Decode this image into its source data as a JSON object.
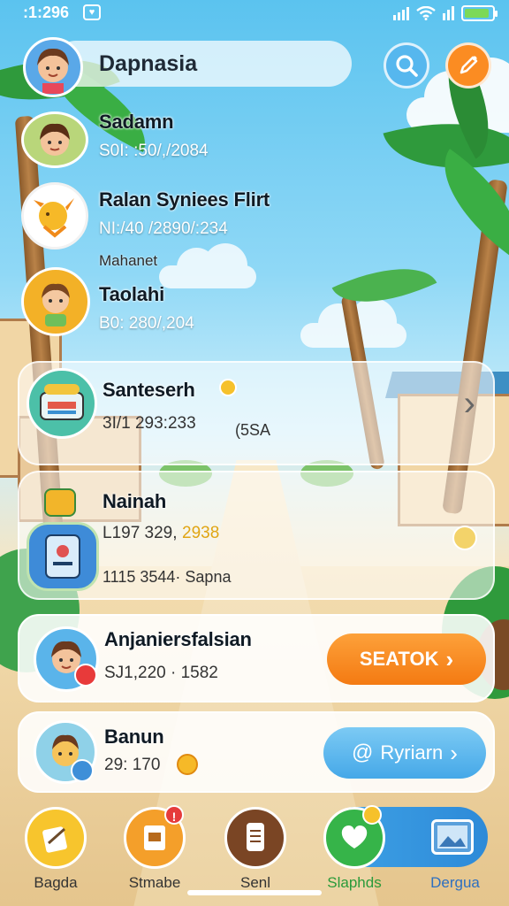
{
  "status_bar": {
    "time": ":1:296",
    "notification_badge": "♥"
  },
  "header": {
    "title": "Dapnasia",
    "search_icon": "search-icon",
    "edit_icon": "pen-icon"
  },
  "contacts": [
    {
      "name": "Sadamn",
      "meta": "S0I: :50/,/2084"
    },
    {
      "name": "Ralan Syniees Flirt",
      "meta": "NI:/40 /2890/:234",
      "sub": "Mahanet"
    },
    {
      "name": "Taolahi",
      "meta": "B0: 280/,204"
    }
  ],
  "cards": [
    {
      "name": "Santeserh",
      "meta": "3I/1 293:233",
      "extra": "(5SA",
      "chevron": "›"
    },
    {
      "name": "Nainah",
      "meta": "L197 329,",
      "highlight": "2938",
      "meta2": "1115 3544· Sapna"
    },
    {
      "name": "Anjaniersfalsian",
      "meta": "SJ1,220 · 1582",
      "button": "SEATOK",
      "button_color": "#f98a1f"
    },
    {
      "name": "Banun",
      "meta": "29: 170",
      "button": "Ryriarn",
      "button_color": "#4fb4ec"
    }
  ],
  "nav": [
    {
      "label": "Bagda",
      "icon": "edit-note-icon"
    },
    {
      "label": "Stmabe",
      "icon": "document-icon",
      "badge": "!"
    },
    {
      "label": "Senl",
      "icon": "scroll-icon"
    },
    {
      "label": "Slaphds",
      "icon": "chat-heart-icon"
    },
    {
      "label": "Dergua",
      "icon": "gallery-icon"
    }
  ],
  "colors": {
    "accent_orange": "#f98a1f",
    "accent_blue": "#4fb4ec",
    "accent_green": "#2fb14a"
  }
}
